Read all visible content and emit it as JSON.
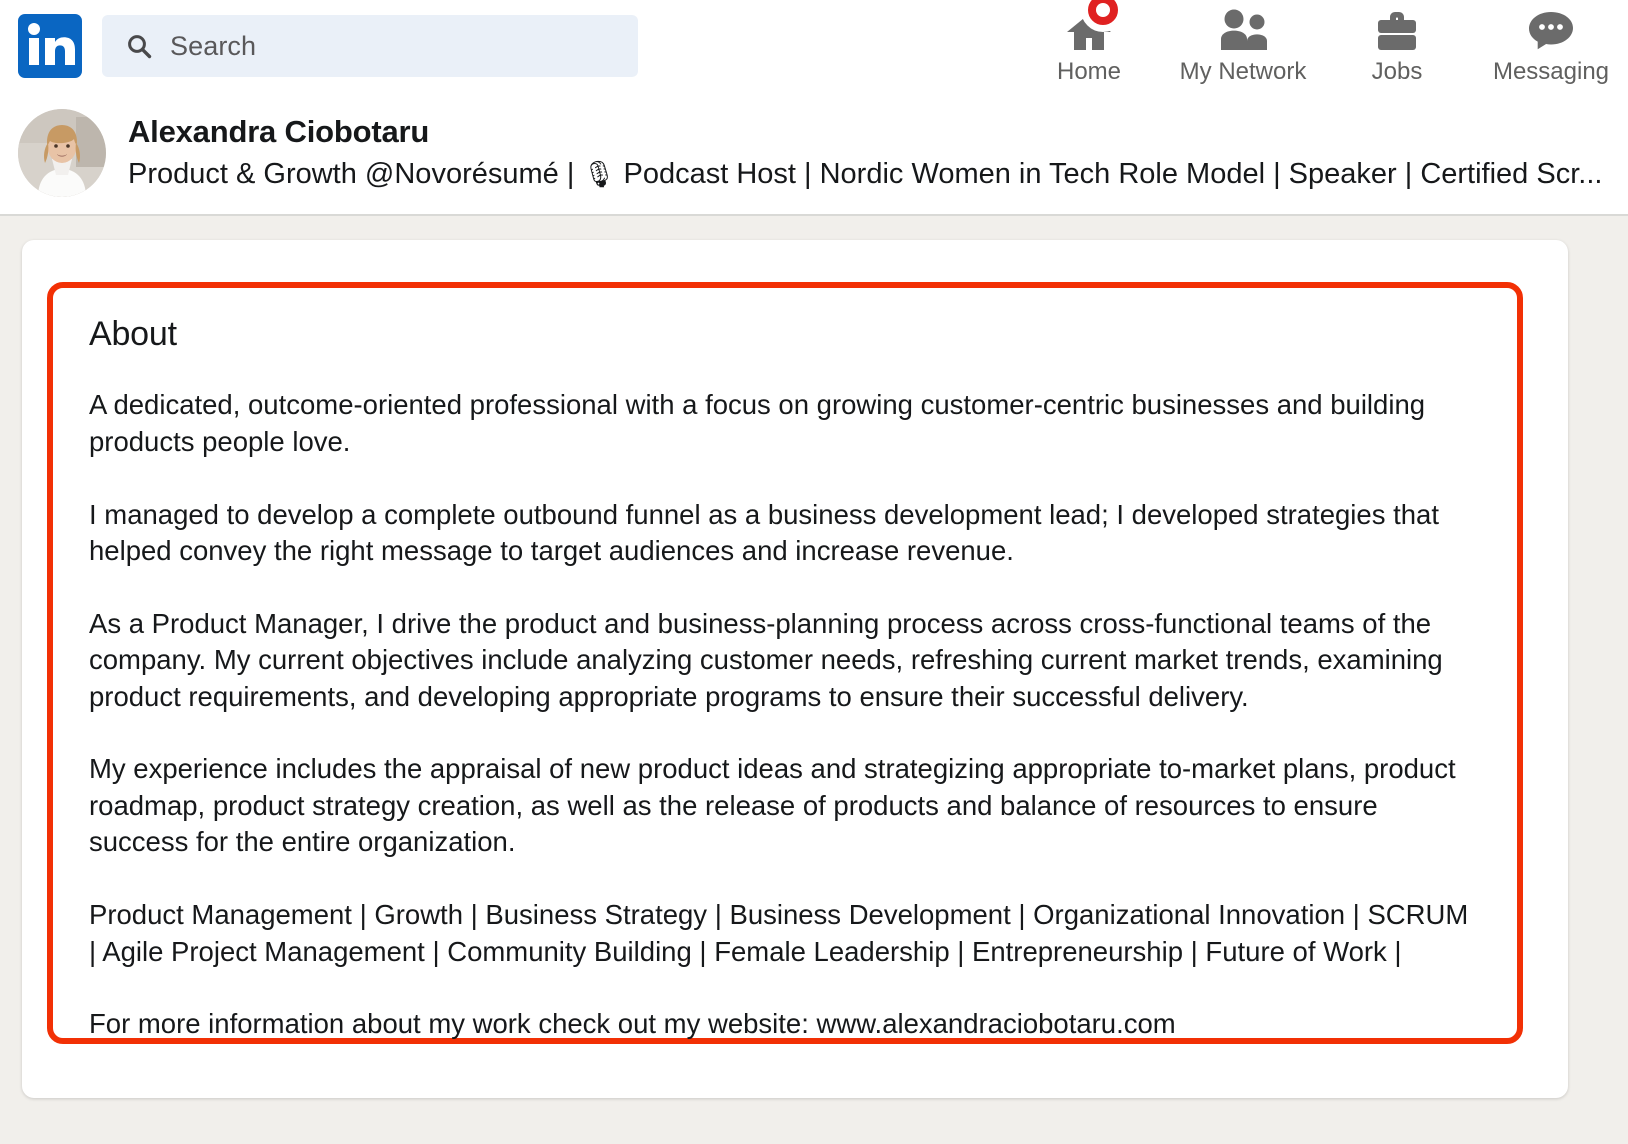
{
  "nav": {
    "logo_alt": "linkedin-logo",
    "search": {
      "placeholder": "Search",
      "value": ""
    },
    "items": [
      {
        "label": "Home",
        "icon": "home-icon",
        "badge": true
      },
      {
        "label": "My Network",
        "icon": "people-icon",
        "badge": false
      },
      {
        "label": "Jobs",
        "icon": "briefcase-icon",
        "badge": false
      },
      {
        "label": "Messaging",
        "icon": "message-bubble-icon",
        "badge": false
      }
    ]
  },
  "profile": {
    "name": "Alexandra Ciobotaru",
    "headline_prefix": "Product & Growth @Novorésumé | ",
    "headline_emoji": "🎙",
    "headline_suffix": " Podcast Host | Nordic Women in Tech Role Model | Speaker | Certified Scr..."
  },
  "about": {
    "title": "About",
    "paragraphs": [
      "A dedicated, outcome-oriented professional with a focus on growing customer-centric businesses and building products people love.",
      "I managed to develop a complete outbound funnel as a business development lead; I developed strategies that helped convey the right message to target audiences and increase revenue.",
      "As a Product Manager, I drive the product and business-planning process across cross-functional teams of the company. My current objectives include analyzing customer needs, refreshing current market trends, examining product requirements, and developing appropriate programs to ensure their successful delivery.",
      "My experience includes the appraisal of new product ideas and strategizing appropriate to-market plans, product roadmap, product strategy creation, as well as the release of products and balance of resources to ensure success for the entire organization.",
      "Product Management | Growth | Business Strategy | Business Development | Organizational Innovation | SCRUM | Agile Project Management | Community Building | Female Leadership | Entrepreneurship | Future of Work |",
      "For more information about my work check out my website: www.alexandraciobotaru.com"
    ]
  },
  "colors": {
    "brand_blue": "#0a66c2",
    "highlight_red": "#f23005",
    "badge_red": "#e02121",
    "page_bg": "#f1efeb",
    "search_bg": "#eaf0f8"
  }
}
